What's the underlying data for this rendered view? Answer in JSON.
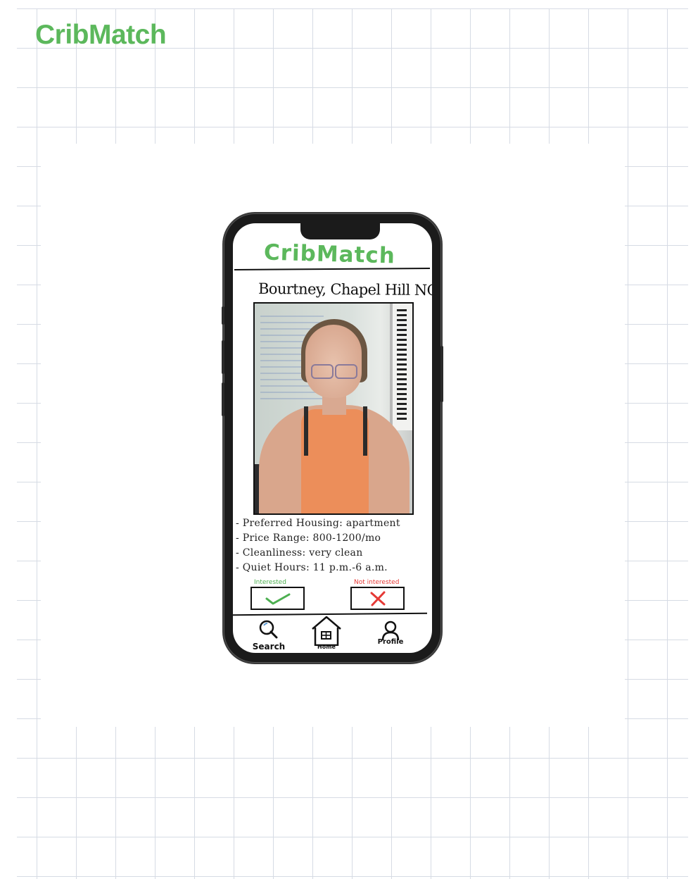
{
  "app_title": "CribMatch",
  "phone": {
    "logo": "CribMatch",
    "profile": {
      "name_location": "Bourtney, Chapel Hill NC",
      "details": [
        "- Preferred Housing: apartment",
        "- Price Range: 800-1200/mo",
        "- Cleanliness: very clean",
        "- Quiet Hours: 11 p.m.-6 a.m."
      ]
    },
    "actions": {
      "interested_label": "Interested",
      "not_interested_label": "Not interested",
      "interested_color": "#4caf50",
      "not_interested_color": "#e53935"
    },
    "bottom_nav": {
      "search": "Search",
      "home": "Home",
      "profile": "Profile"
    }
  },
  "colors": {
    "brand_green": "#5cb85c",
    "grid_line": "#d6dbe4"
  }
}
